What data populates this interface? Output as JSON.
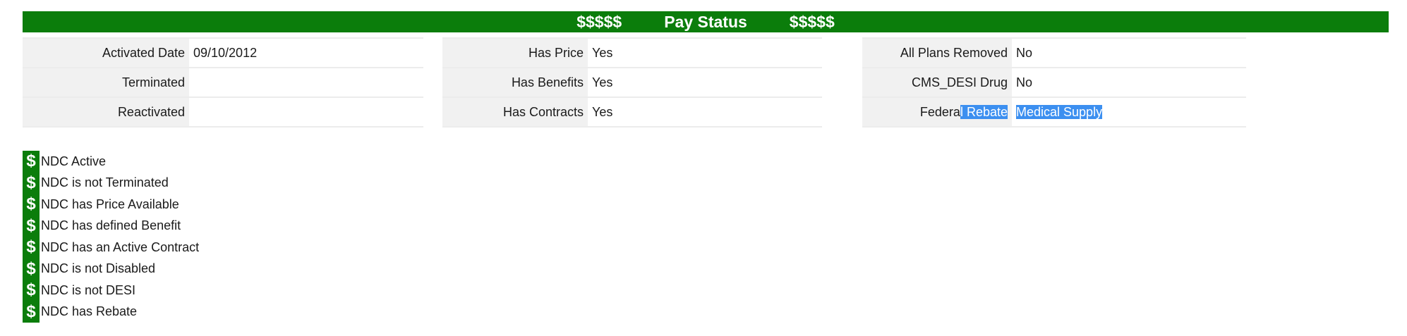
{
  "banner": {
    "left_symbols": "$$$$$",
    "title": "Pay Status",
    "right_symbols": "$$$$$"
  },
  "colors": {
    "accent_green": "#0b7d0b",
    "label_background": "#f1f1f1",
    "selection_highlight": "#3c8ff0"
  },
  "status_tables": [
    {
      "rows": [
        {
          "label": "Activated Date",
          "value": "09/10/2012"
        },
        {
          "label": "Terminated",
          "value": ""
        },
        {
          "label": "Reactivated",
          "value": ""
        }
      ]
    },
    {
      "rows": [
        {
          "label": "Has Price",
          "value": "Yes"
        },
        {
          "label": "Has Benefits",
          "value": "Yes"
        },
        {
          "label": "Has Contracts",
          "value": "Yes"
        }
      ]
    },
    {
      "rows": [
        {
          "label": "All Plans Removed",
          "value": "No"
        },
        {
          "label": "CMS_DESI Drug",
          "value": "No"
        },
        {
          "label_start": "Federa",
          "label_selected": "l Rebate",
          "value": "Medical Supply"
        }
      ]
    }
  ],
  "checklist": {
    "icon": "dollar-icon",
    "icon_glyph": "$",
    "items": [
      "NDC Active",
      "NDC is not Terminated",
      "NDC has Price Available",
      "NDC has defined Benefit",
      "NDC has an Active Contract",
      "NDC is not Disabled",
      "NDC is not DESI",
      "NDC has Rebate"
    ]
  }
}
